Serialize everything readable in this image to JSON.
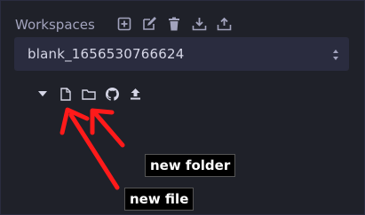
{
  "workspaces": {
    "title": "Workspaces",
    "selected": "blank_1656530766624",
    "icons": [
      "plus-square-icon",
      "edit-icon",
      "trash-icon",
      "download-icon",
      "upload-icon"
    ]
  },
  "file_tree": {
    "icons": [
      "caret-down-icon",
      "new-file-icon",
      "new-folder-icon",
      "github-icon",
      "upload-icon"
    ]
  },
  "annotations": {
    "new_folder": "new folder",
    "new_file": "new file",
    "arrow_color": "#ff1a1a"
  }
}
